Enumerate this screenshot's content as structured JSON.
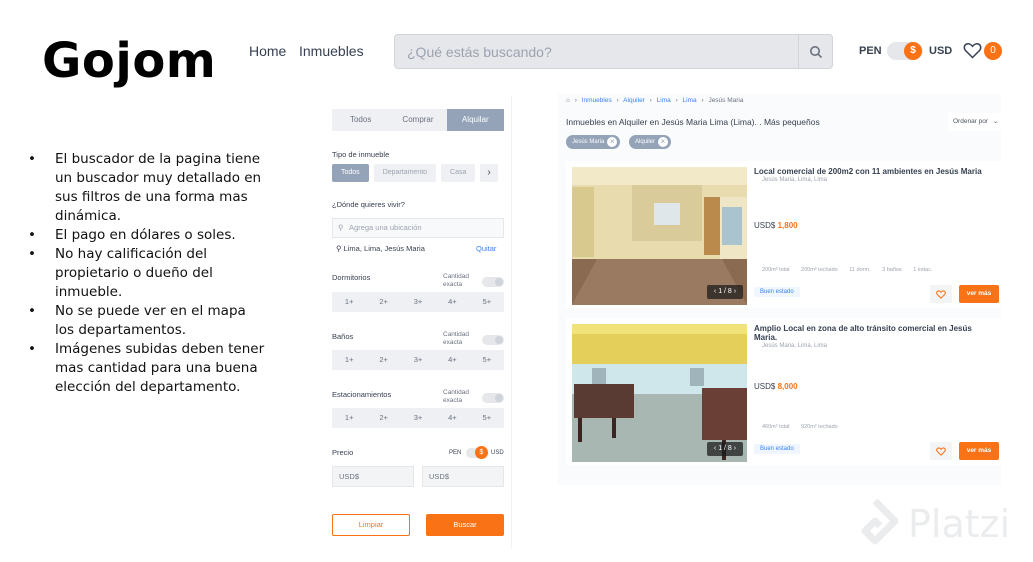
{
  "brand": "Gojom",
  "notes": [
    "El buscador de la pagina  tiene un buscador muy detallado en sus filtros de una forma mas dinámica.",
    "El pago en dólares o soles.",
    "No hay calificación del propietario o dueño del inmueble.",
    "No se puede ver en el mapa los departamentos.",
    "Imágenes subidas deben tener mas cantidad para una buena elección del departamento."
  ],
  "nav": {
    "home": "Home",
    "listings": "Inmuebles"
  },
  "search": {
    "placeholder": "¿Qué estás buscando?"
  },
  "currency": {
    "left": "PEN",
    "symbol": "$",
    "right": "USD"
  },
  "favorites": {
    "count": "0"
  },
  "filters": {
    "tabs": [
      "Todos",
      "Comprar",
      "Alquilar"
    ],
    "active_tab": "Alquilar",
    "type_label": "Tipo de inmueble",
    "types": [
      "Todos",
      "Departamento",
      "Casa"
    ],
    "location_label": "¿Dónde quieres vivir?",
    "location_placeholder": "Agrega una ubicación",
    "location_selected": "Lima, Lima, Jesús Maria",
    "location_remove": "Quitar",
    "exact": "Cantidad exacta",
    "rooms_label": "Dormitorios",
    "baths_label": "Baños",
    "parking_label": "Estacionamientos",
    "options": [
      "1+",
      "2+",
      "3+",
      "4+",
      "5+"
    ],
    "price_label": "Precio",
    "price_cur_left": "PEN",
    "price_cur_symbol": "$",
    "price_cur_right": "USD",
    "price_min": "USD$",
    "price_max": "USD$",
    "clear": "Limpiar",
    "submit": "Buscar"
  },
  "results": {
    "breadcrumb": [
      "Inmuebles",
      "Alquiler",
      "Lima",
      "Lima",
      "Jesús Maria"
    ],
    "title": "Inmuebles en Alquiler en Jesús Maria Lima (Lima). . Más pequeños",
    "order": "Ordenar por",
    "chips": [
      "Jesús Maria",
      "Alquiler"
    ],
    "listings": [
      {
        "title": "Local comercial de 200m2 con 11 ambientes en Jesús Maria",
        "address": "Jesús Maria, Lima, Lima",
        "currency": "USD$",
        "price": "1,800",
        "features": [
          "200m² total",
          "200m² techado",
          "11 dorm.",
          "3 baños",
          "1 estac."
        ],
        "badge": "Buen estado",
        "photo_count": "1 / 8",
        "cta": "ver más"
      },
      {
        "title": "Amplio Local en zona de alto tránsito comercial en Jesús Maria.",
        "address": "Jesús Maria, Lima, Lima",
        "currency": "USD$",
        "price": "8,000",
        "features": [
          "460m² total",
          "920m² techado"
        ],
        "badge": "Buen estado",
        "photo_count": "1 / 8",
        "cta": "ver más"
      }
    ]
  },
  "watermark": "Platzi",
  "colors": {
    "accent": "#f97316",
    "slate": "#94a3b8",
    "link": "#3b82f6"
  }
}
